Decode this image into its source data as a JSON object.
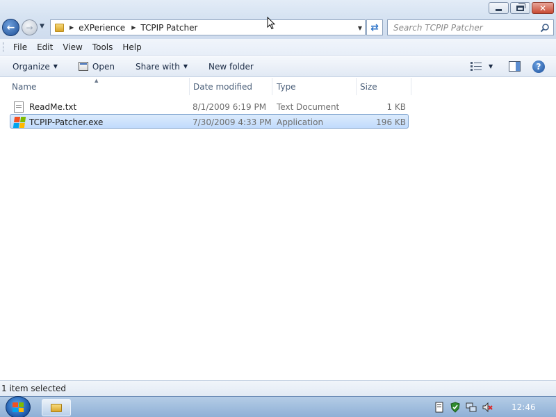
{
  "window": {
    "caption_buttons": {
      "minimize": "minimize",
      "maximize": "maximize",
      "close": "✕"
    }
  },
  "nav": {
    "breadcrumbs": [
      "eXPerience",
      "TCPIP Patcher"
    ],
    "search_placeholder": "Search TCPIP Patcher"
  },
  "menu": {
    "items": [
      "File",
      "Edit",
      "View",
      "Tools",
      "Help"
    ]
  },
  "commands": {
    "organize": "Organize",
    "open": "Open",
    "share_with": "Share with",
    "new_folder": "New folder"
  },
  "columns": {
    "name": "Name",
    "date_modified": "Date modified",
    "type": "Type",
    "size": "Size"
  },
  "files": [
    {
      "name": "ReadMe.txt",
      "date_modified": "8/1/2009 6:19 PM",
      "type": "Text Document",
      "size": "1 KB",
      "icon": "text-file-icon",
      "selected": false
    },
    {
      "name": "TCPIP-Patcher.exe",
      "date_modified": "7/30/2009 4:33 PM",
      "type": "Application",
      "size": "196 KB",
      "icon": "application-icon",
      "selected": true
    }
  ],
  "status": {
    "text": "1 item selected"
  },
  "taskbar": {
    "clock": "12:46",
    "tray_icons": [
      "action-center-icon",
      "security-icon",
      "network-icon",
      "volume-muted-icon"
    ]
  },
  "colors": {
    "selection": "#c1dbfc",
    "selection_border": "#7da2ce",
    "taskbar": "#8fb0d6"
  }
}
